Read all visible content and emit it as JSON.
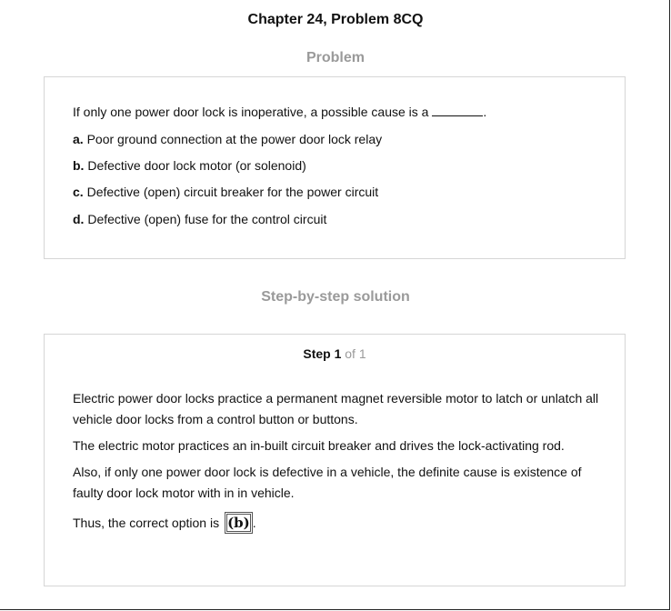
{
  "page": {
    "title": "Chapter 24, Problem 8CQ"
  },
  "problem": {
    "heading": "Problem",
    "question_start": "If only one power door lock is inoperative, a possible cause is a",
    "question_end": ".",
    "options": [
      {
        "letter": "a.",
        "text": " Poor ground connection at the power door lock relay"
      },
      {
        "letter": "b.",
        "text": " Defective door lock motor (or solenoid)"
      },
      {
        "letter": "c.",
        "text": " Defective (open) circuit breaker for the power circuit"
      },
      {
        "letter": "d.",
        "text": " Defective (open) fuse for the control circuit"
      }
    ]
  },
  "solution": {
    "heading": "Step-by-step solution",
    "step_label": "Step 1",
    "step_of": "of 1",
    "paragraphs": [
      "Electric power door locks practice a permanent magnet reversible motor to latch or unlatch all vehicle door locks from a control button or buttons.",
      "The electric motor practices an in-built circuit breaker and drives the lock-activating rod.",
      "Also, if only one power door lock is defective in a vehicle, the definite cause is existence of faulty door lock motor with in in vehicle."
    ],
    "conclusion_text": "Thus, the correct option is",
    "answer": "(b)",
    "conclusion_end": "."
  }
}
